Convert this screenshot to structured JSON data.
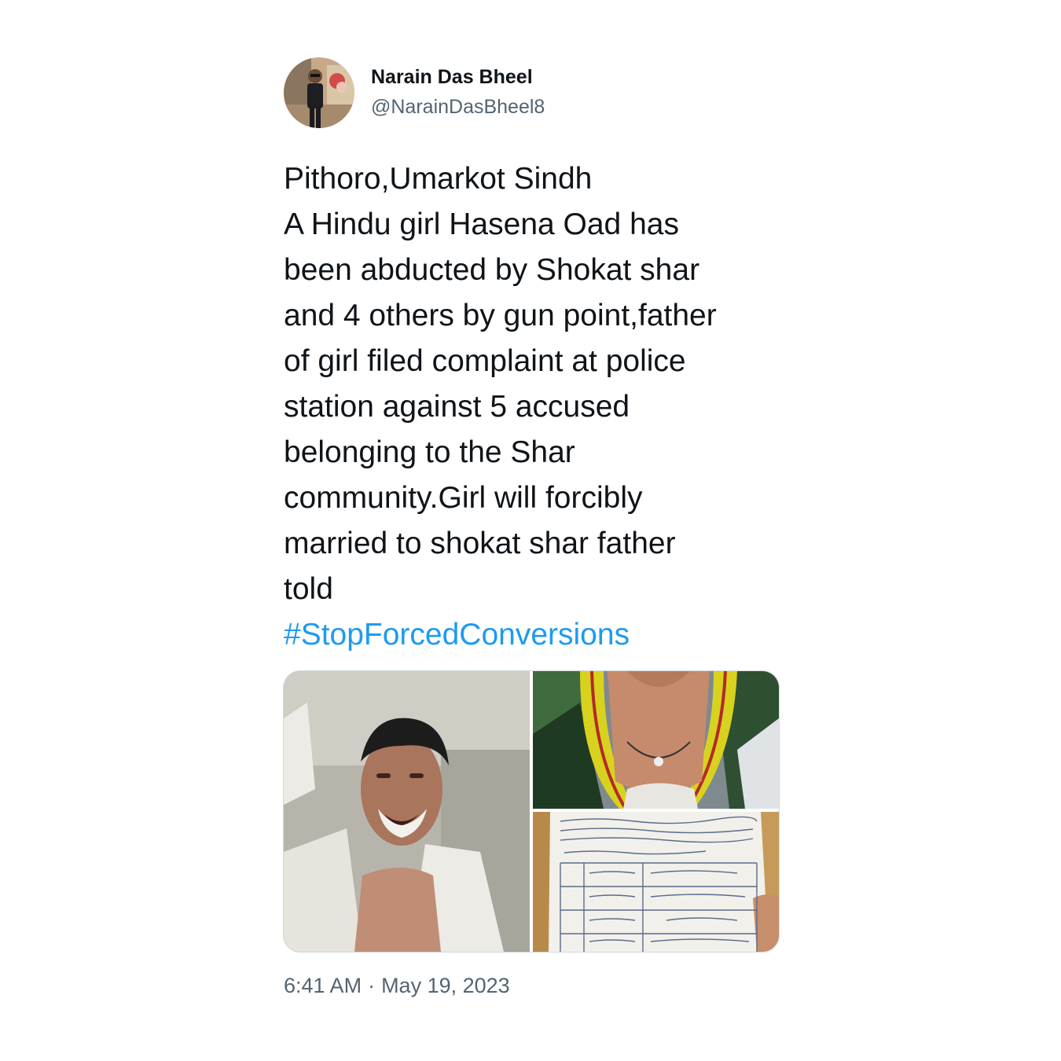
{
  "author": {
    "display_name": "Narain Das Bheel",
    "handle": "@NarainDasBheel8"
  },
  "tweet": {
    "text_lines": [
      "Pithoro,Umarkot Sindh",
      "A Hindu girl Hasena Oad has",
      "been abducted by Shokat shar",
      "and 4 others by gun point,father",
      "of girl filed complaint at police",
      "station against 5 accused",
      "belonging to the Shar",
      "community.Girl will forcibly",
      "married to shokat shar father",
      "told"
    ],
    "hashtag": "#StopForcedConversions"
  },
  "media": {
    "photo_count": 3
  },
  "meta": {
    "time": "6:41 AM",
    "separator": "·",
    "date": "May 19, 2023"
  },
  "colors": {
    "text": "#0f1419",
    "secondary": "#536471",
    "link": "#1d9bf0",
    "border": "#cfd9de"
  }
}
